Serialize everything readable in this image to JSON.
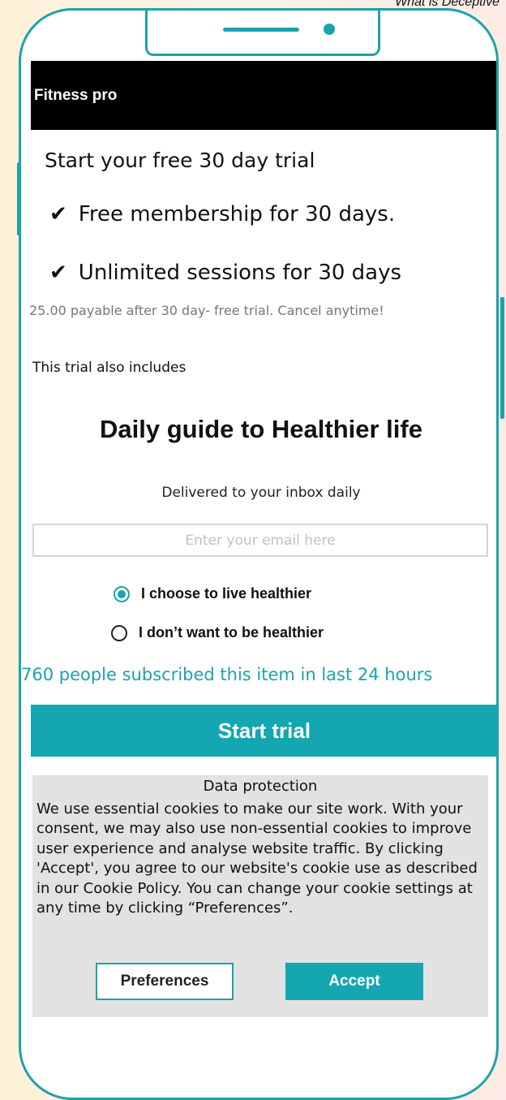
{
  "page_caption": "What is Deceptive",
  "app": {
    "title": "Fitness pro"
  },
  "offer": {
    "headline": "Start your free 30 day trial",
    "features": [
      {
        "check": "✔",
        "text": "Free membership for 30 days."
      },
      {
        "check": "✔",
        "text": "Unlimited sessions for 30 days"
      }
    ],
    "fine_print": "25.00 payable after 30 day- free trial.  Cancel anytime!",
    "includes_label": "This trial also includes"
  },
  "newsletter": {
    "title": "Daily guide to Healthier life",
    "subtitle": "Delivered to your inbox daily",
    "email_placeholder": "Enter your email here",
    "email_value": "",
    "options": [
      {
        "label": "I choose to live healthier",
        "selected": true
      },
      {
        "label": "I don’t want to be healthier",
        "selected": false
      }
    ]
  },
  "social_proof": "760 people subscribed this item in last 24 hours",
  "cta": {
    "label": "Start trial"
  },
  "cookie_banner": {
    "title": "Data protection",
    "text": "We use essential cookies to make our site work. With your consent, we may also use non-essential cookies to improve user experience and analyse website traffic. By clicking 'Accept', you agree to our website's cookie use as described in our Cookie Policy. You can change your cookie settings at any time by clicking “Preferences”.",
    "preferences_label": "Preferences",
    "accept_label": "Accept"
  },
  "colors": {
    "accent": "#1aa3ad",
    "header_bg": "#000000",
    "cookie_bg": "#e2e2e2"
  }
}
